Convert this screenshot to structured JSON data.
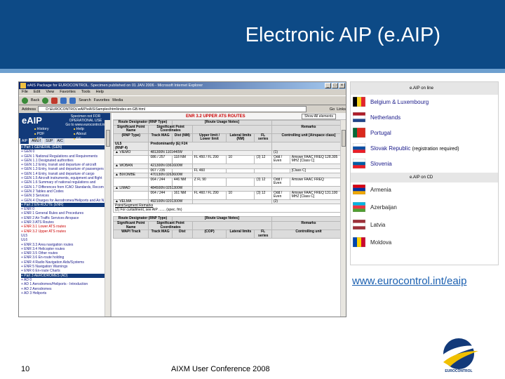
{
  "slide": {
    "title": "Electronic AIP (e.AIP)",
    "page_number": "10",
    "footer_text": "AIXM User Conference 2008",
    "url": "www.eurocontrol.int/eaip",
    "logo_text": "EUROCONTROL",
    "header_color": "#0d4a86"
  },
  "browser": {
    "window_title": "eAIS Package for EUROCONTROL. Specimen published on 01 JAN 2006 - Microsoft Internet Explorer",
    "menu": [
      "File",
      "Edit",
      "View",
      "Favorites",
      "Tools",
      "Help"
    ],
    "toolbar": [
      "Back",
      "Search",
      "Favorites",
      "Media"
    ],
    "address_label": "Address",
    "address": "D:\\EUROCONTROL\\eAIP\\eAIS\\Samples\\html\\index-en-GB.html",
    "go_label": "Go",
    "links_label": "Links"
  },
  "left_frame": {
    "logo": "eAIP",
    "specimen": "Specimen not FOR OPERATIONAL USE",
    "specimen_sub": "Go to www.eurocontrol.int",
    "nav": [
      "History",
      "Help",
      "PDF",
      "About",
      "EN",
      "EE"
    ],
    "tabs": [
      "AIP",
      "AMDT",
      "SUP",
      "AIC"
    ],
    "tree": [
      {
        "text": "+ Part 1 GENERAL (GEN)",
        "style": "hl"
      },
      {
        "text": "+ GEN 0",
        "style": ""
      },
      {
        "text": "+ GEN 1 National Regulations and Requirements",
        "style": ""
      },
      {
        "text": "  + GEN 1.1 Designated authorities",
        "style": ""
      },
      {
        "text": "  + GEN 1.2 Entry, transit and departure of aircraft",
        "style": ""
      },
      {
        "text": "  + GEN 1.3 Entry, transit and departure of passengers",
        "style": ""
      },
      {
        "text": "  + GEN 1.4 Entry, transit and departure of cargo",
        "style": ""
      },
      {
        "text": "  + GEN 1.5 Aircraft instruments, equipment and flight",
        "style": ""
      },
      {
        "text": "  + GEN 1.6 Summary of national regulations and",
        "style": ""
      },
      {
        "text": "  + GEN 1.7 Differences from ICAO Standards, Recom",
        "style": ""
      },
      {
        "text": "+ GEN 2 Tables and Codes",
        "style": ""
      },
      {
        "text": "+ GEN 3 Services",
        "style": ""
      },
      {
        "text": "+ GEN 4 Charges for Aerodromes/Heliports and Air N",
        "style": ""
      },
      {
        "text": "+ Part 2 EN-ROUTE (ENR)",
        "style": "hl"
      },
      {
        "text": "+ ENR 0",
        "style": ""
      },
      {
        "text": "+ ENR 1 General Rules and Procedures",
        "style": ""
      },
      {
        "text": "+ ENR 2 Air Traffic Services Airspace",
        "style": ""
      },
      {
        "text": "+ ENR 3 ATS Routes",
        "style": ""
      },
      {
        "text": "  + ENR 3.1 Lower ATS routes",
        "style": "red"
      },
      {
        "text": "  + ENR 3.2 Upper ATS routes",
        "style": "red"
      },
      {
        "text": "     UL5",
        "style": ""
      },
      {
        "text": "     UL6",
        "style": ""
      },
      {
        "text": "  + ENR 3.3 Area navigation routes",
        "style": ""
      },
      {
        "text": "  + ENR 3.4 Helicopter routes",
        "style": ""
      },
      {
        "text": "  + ENR 3.5 Other routes",
        "style": ""
      },
      {
        "text": "  + ENR 3.6 En-route holding",
        "style": ""
      },
      {
        "text": "+ ENR 4 Radio Navigation Aids/Systems",
        "style": ""
      },
      {
        "text": "+ ENR 5 Navigation Warnings",
        "style": ""
      },
      {
        "text": "+ ENR 6 En-route Charts",
        "style": ""
      },
      {
        "text": "+ Part 3 AERODROMES (AD)",
        "style": "hl"
      },
      {
        "text": "+ AD 0",
        "style": ""
      },
      {
        "text": "+ AD 1 Aerodromes/Heliports - Introduction",
        "style": ""
      },
      {
        "text": "+ AD 2 Aerodromes",
        "style": ""
      },
      {
        "text": "+ AD 3 Heliports",
        "style": ""
      }
    ]
  },
  "right_frame": {
    "section_title": "ENR 3.2 UPPER ATS ROUTES",
    "show_label": "Show All elements",
    "headers": {
      "route": "Route Designator (RNP Type)",
      "usage": "[Route Usage Notes]",
      "sig": "Significant Point Name",
      "sig_coords": "Significant Point Coordinates",
      "remarks": "Remarks",
      "rnp": "(RNP Type)",
      "track": "Track MAG",
      "dist": "Dist (NM)",
      "cop": "(COP)",
      "limits": "Upper limit / Lower limit",
      "lateral": "Lateral limits (NM)",
      "fl": "FL series",
      "controlling": "Controlling unit [Airspace class]",
      "num1": "1",
      "num2": "2",
      "num3": "3"
    },
    "route1": {
      "name": "UL5",
      "rnp": "(RNP 4)",
      "usage": "Predominantly (E) F24"
    },
    "points": [
      {
        "name": "▲ VIEMO",
        "coords": "481300N 1101440W",
        "remarks": "(1)"
      },
      {
        "track": "086 / 257",
        "dist": "118 NM",
        "limits": "FL 450 / FL 290",
        "lateral": "10",
        "fl": "Odd / Even",
        "ctrl": "Amswe FAAC FREQ 128.305 MHZ [Class C]",
        "note": "(3) 12"
      },
      {
        "name": "▲ WOBAN",
        "coords": "421300N 0361600W",
        "remarks": ""
      },
      {
        "track": "067 / 235",
        "dist": "",
        "limits": "FL 460",
        "lateral": "",
        "fl": "",
        "ctrl": "[Class C]",
        "note": ""
      },
      {
        "name": "▲ BIXOMBE",
        "coords": "470130N 0263600W",
        "remarks": ""
      },
      {
        "track": "064 / 244",
        "dist": "446 NM",
        "limits": "Z FL 90",
        "lateral": "",
        "fl": "Odd / Even",
        "ctrl": "Amswe FAAC FREQ",
        "note": "(3) 12"
      },
      {
        "name": "▲ LIMAD",
        "coords": "484500N 0251300W",
        "remarks": ""
      },
      {
        "track": "064 / 244",
        "dist": "161 NM",
        "limits": "FL 460 / FL 290",
        "lateral": "10",
        "fl": "Odd / Even",
        "ctrl": "Amswe FAAC FREQ 131.100 MHZ [Class C]",
        "note": "(3) 12"
      },
      {
        "name": "▲ VELMA",
        "coords": "492100N 0201300W",
        "remarks": "(2)"
      }
    ],
    "remarks_title": "Point/Segment Remarks",
    "remarks_line": "(2) For curtailment, see AIP ....... (spec. fm)",
    "route2_usage": "[Route Usage Notes]",
    "route2_remarks": "Remarks",
    "route2_controlling": "Controlling unit",
    "route2_lateral": "Lateral limits",
    "route2_fl": "FL series",
    "route2_trackrow": "WAPI Track",
    "route2_track": "Track MAG",
    "route2_dist": "Dist",
    "route2_cop": "(COP)"
  },
  "eaip_online": {
    "heading": "e.AIP on line",
    "countries": [
      {
        "name": "Belgium & Luxembourg",
        "note": ""
      },
      {
        "name": "Netherlands",
        "note": ""
      },
      {
        "name": "Portugal",
        "note": ""
      },
      {
        "name": "Slovak Republic",
        "note": "(registration required)"
      },
      {
        "name": "Slovenia",
        "note": ""
      }
    ]
  },
  "eaip_cd": {
    "heading": "e.AIP on CD",
    "countries": [
      {
        "name": "Armenia"
      },
      {
        "name": "Azerbaijan"
      },
      {
        "name": "Latvia"
      },
      {
        "name": "Moldova"
      }
    ]
  }
}
